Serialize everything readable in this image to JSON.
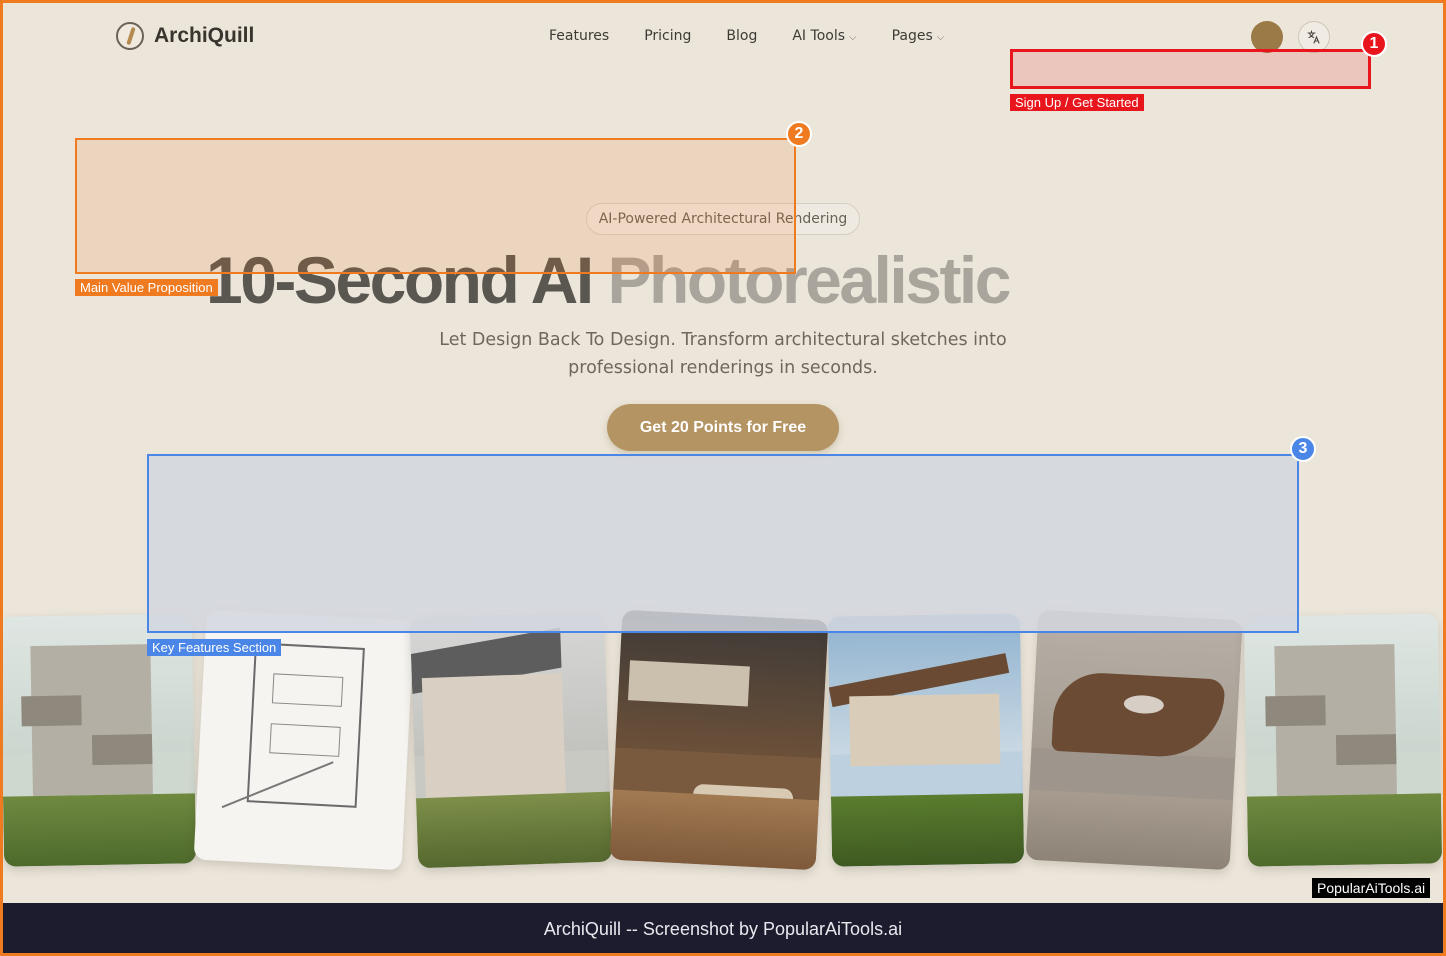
{
  "brand": {
    "name": "ArchiQuill"
  },
  "nav": {
    "links": [
      {
        "label": "Features"
      },
      {
        "label": "Pricing"
      },
      {
        "label": "Blog"
      },
      {
        "label": "AI Tools",
        "dropdown": true
      },
      {
        "label": "Pages",
        "dropdown": true
      }
    ],
    "lang_icon": "translate-icon"
  },
  "hero": {
    "badge": "AI-Powered Architectural Rendering",
    "headline_dark": "10-Second AI",
    "headline_light": "Photorealistic",
    "subtitle": "Let Design Back To Design. Transform architectural sketches into professional renderings in seconds.",
    "cta": "Get 20 Points for Free"
  },
  "annotations": [
    {
      "num": "1",
      "label": "Sign Up / Get Started",
      "color": "#e8161c"
    },
    {
      "num": "2",
      "label": "Main Value Proposition",
      "color": "#f07a1f"
    },
    {
      "num": "3",
      "label": "Key Features Section",
      "color": "#4a86e8"
    }
  ],
  "watermark": "PopularAiTools.ai",
  "footer": "ArchiQuill -- Screenshot by PopularAiTools.ai",
  "colors": {
    "accent": "#b49463",
    "background": "#ece6da",
    "footer": "#1c1c2e"
  }
}
